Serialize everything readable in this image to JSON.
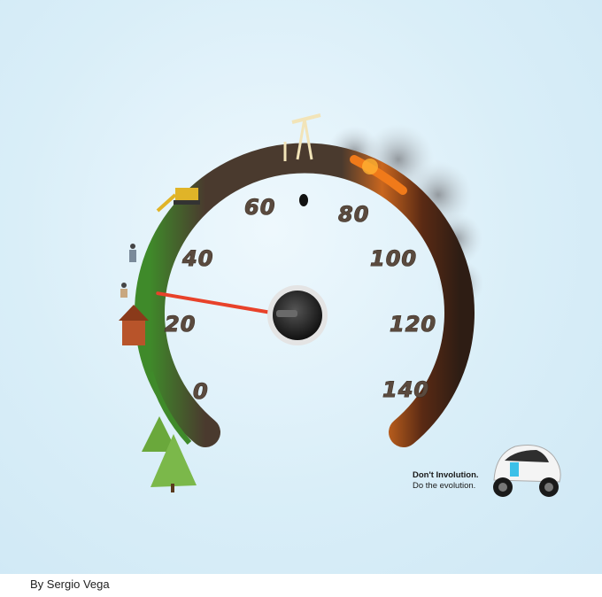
{
  "gauge": {
    "ticks": [
      "0",
      "20",
      "40",
      "60",
      "80",
      "100",
      "120",
      "140"
    ],
    "needle_value": 25,
    "max_value": 140
  },
  "slogan": {
    "line1": "Don't Involution.",
    "line2": "Do the evolution."
  },
  "credit": "By Sergio Vega",
  "colors": {
    "soil": "#4a3a2e",
    "grass": "#3f8a2a",
    "fire": "#f07a1a",
    "needle": "#e8422a",
    "sky": "#d9eef8"
  },
  "icons": [
    "tree-icon",
    "house-icon",
    "people-icon",
    "excavator-icon",
    "oil-pump-icon",
    "smoke-icon",
    "car-icon"
  ]
}
